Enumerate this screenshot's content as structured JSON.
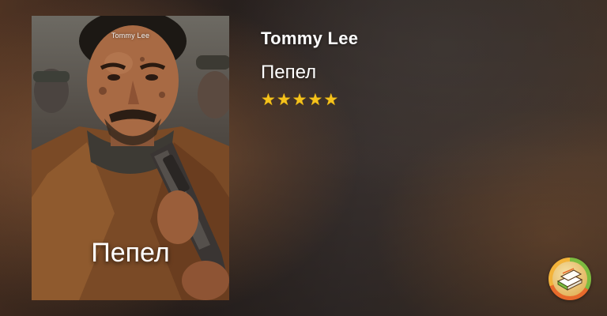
{
  "book": {
    "author": "Tommy Lee",
    "title": "Пепел",
    "rating": 5,
    "stars": [
      "★",
      "★",
      "★",
      "★",
      "★"
    ]
  },
  "cover": {
    "author": "Tommy Lee",
    "title": "Пепел"
  },
  "logo": {
    "icon": "book-stack-logo-icon"
  },
  "colors": {
    "star": "#f5c21b",
    "text": "#ffffff",
    "logo_green": "#7cbb3f",
    "logo_orange": "#e86a2b"
  }
}
